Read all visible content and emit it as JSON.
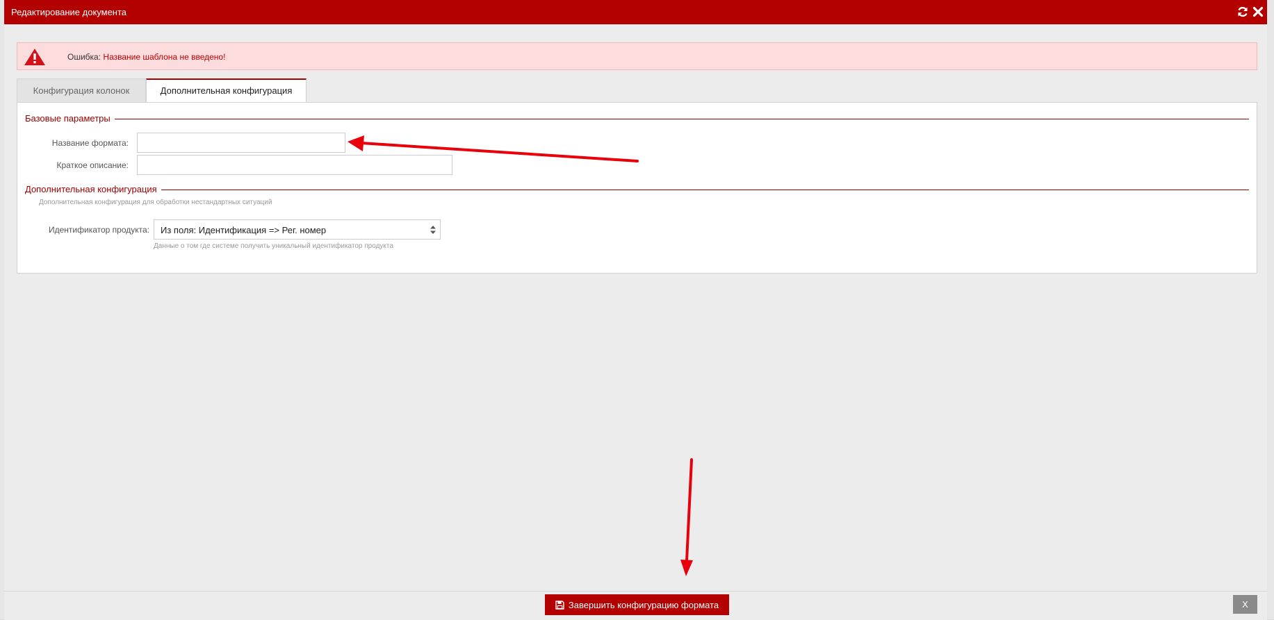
{
  "dialog": {
    "title": "Редактирование документа",
    "icons": [
      "refresh-icon",
      "close-icon"
    ]
  },
  "alert": {
    "prefix": "Ошибка:",
    "message": "Название шаблона не введено!",
    "icon": "warning-triangle-icon"
  },
  "tabs": [
    {
      "label": "Конфигурация колонок",
      "active": false
    },
    {
      "label": "Дополнительная конфигурация",
      "active": true
    }
  ],
  "basic_section": {
    "title": "Базовые параметры",
    "format_name_label": "Название формата:",
    "format_name_value": "",
    "short_description_label": "Краткое описание:",
    "short_description_value": ""
  },
  "extra_section": {
    "title": "Дополнительная конфигурация",
    "hint": "Дополнительная конфигурация для обработки нестандартных ситуаций",
    "product_id_label": "Идентификатор продукта:",
    "product_id_value": "Из поля: Идентификация => Рег. номер",
    "product_id_hint": "Данные о том где системе получить уникальный идентификатор продукта"
  },
  "footer": {
    "finish_label": "Завершить конфигурацию формата",
    "finish_icon": "save-icon",
    "close_label": "X"
  },
  "colors": {
    "brand": "#b30000",
    "alert_bg": "#fcdcdc",
    "annotation_arrow": "#e8000b"
  }
}
